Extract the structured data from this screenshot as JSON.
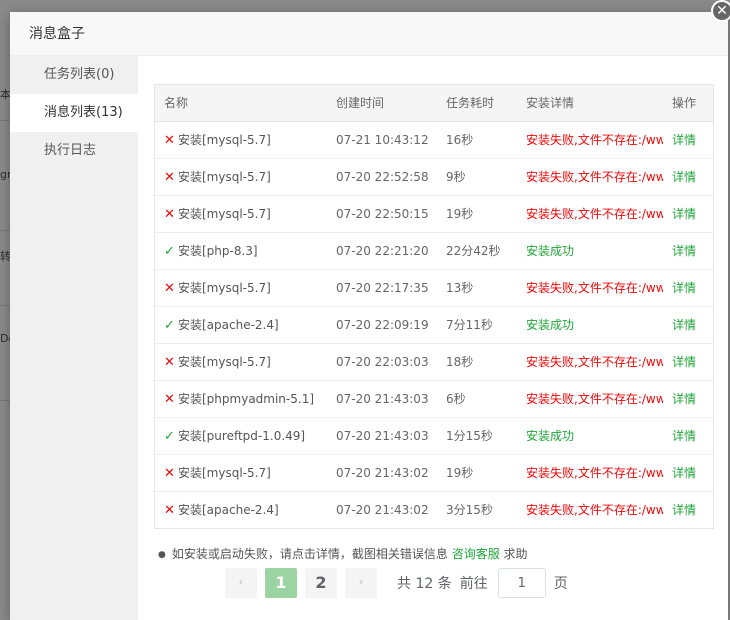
{
  "background": {
    "fragments": [
      "本",
      "gr",
      "转",
      "Do"
    ]
  },
  "dialog": {
    "title": "消息盒子",
    "close_glyph": "✕"
  },
  "sidebar": {
    "items": [
      {
        "label": "任务列表(0)",
        "active": false
      },
      {
        "label": "消息列表(13)",
        "active": true
      },
      {
        "label": "执行日志",
        "active": false
      }
    ]
  },
  "table": {
    "columns": [
      "名称",
      "创建时间",
      "任务耗时",
      "安装详情",
      "操作"
    ],
    "rows": [
      {
        "status": "fail",
        "name": "安装[mysql-5.7]",
        "time": "07-21 10:43:12",
        "duration": "16秒",
        "detail": "安装失败,文件不存在:/www/server/panel/install/mysql.sh",
        "op": "详情"
      },
      {
        "status": "fail",
        "name": "安装[mysql-5.7]",
        "time": "07-20 22:52:58",
        "duration": "9秒",
        "detail": "安装失败,文件不存在:/www/server/panel/install/mysql.sh",
        "op": "详情"
      },
      {
        "status": "fail",
        "name": "安装[mysql-5.7]",
        "time": "07-20 22:50:15",
        "duration": "19秒",
        "detail": "安装失败,文件不存在:/www/server/panel/install/mysql.sh",
        "op": "详情"
      },
      {
        "status": "ok",
        "name": "安装[php-8.3]",
        "time": "07-20 22:21:20",
        "duration": "22分42秒",
        "detail": "安装成功",
        "op": "详情"
      },
      {
        "status": "fail",
        "name": "安装[mysql-5.7]",
        "time": "07-20 22:17:35",
        "duration": "13秒",
        "detail": "安装失败,文件不存在:/www/server/panel/install/mysql.sh",
        "op": "详情"
      },
      {
        "status": "ok",
        "name": "安装[apache-2.4]",
        "time": "07-20 22:09:19",
        "duration": "7分11秒",
        "detail": "安装成功",
        "op": "详情"
      },
      {
        "status": "fail",
        "name": "安装[mysql-5.7]",
        "time": "07-20 22:03:03",
        "duration": "18秒",
        "detail": "安装失败,文件不存在:/www/server/panel/install/mysql.sh",
        "op": "详情"
      },
      {
        "status": "fail",
        "name": "安装[phpmyadmin-5.1]",
        "time": "07-20 21:43:03",
        "duration": "6秒",
        "detail": "安装失败,文件不存在:/www/server/panel/install/mysql.sh",
        "op": "详情"
      },
      {
        "status": "ok",
        "name": "安装[pureftpd-1.0.49]",
        "time": "07-20 21:43:03",
        "duration": "1分15秒",
        "detail": "安装成功",
        "op": "详情"
      },
      {
        "status": "fail",
        "name": "安装[mysql-5.7]",
        "time": "07-20 21:43:02",
        "duration": "19秒",
        "detail": "安装失败,文件不存在:/www/server/panel/install/mysql.sh",
        "op": "详情"
      },
      {
        "status": "fail",
        "name": "安装[apache-2.4]",
        "time": "07-20 21:43:02",
        "duration": "3分15秒",
        "detail": "安装失败,文件不存在:/www/server/panel/install/mysql.sh",
        "op": "详情"
      }
    ]
  },
  "tip": {
    "text": "如安装或启动失败，请点击详情，截图相关错误信息",
    "link": "咨询客服",
    "suffix": "求助"
  },
  "pagination": {
    "prev_glyph": "‹",
    "next_glyph": "›",
    "pages": [
      "1",
      "2"
    ],
    "current": "1",
    "total_text": "共 12 条",
    "goto_label": "前往",
    "goto_value": "1",
    "unit_label": "页"
  },
  "colors": {
    "success": "#20a53a",
    "error": "#ef0808",
    "active_page": "#9bd3a2"
  },
  "icons": {
    "fail": "close-icon",
    "ok": "check-icon"
  }
}
